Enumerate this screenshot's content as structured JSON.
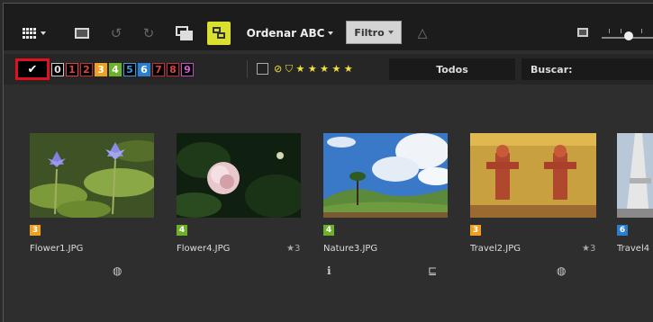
{
  "toolbar": {
    "sort_label": "Ordenar ABC",
    "filter_label": "Filtro",
    "accent_color": "#d9e030"
  },
  "filterbar": {
    "check_glyph": "✔",
    "labels": [
      {
        "text": "0",
        "bg": "#000000",
        "fg": "#e0e0e0",
        "border": "#c8c8c8"
      },
      {
        "text": "1",
        "bg": "#000000",
        "fg": "#e04040",
        "border": "#e04040"
      },
      {
        "text": "2",
        "bg": "#000000",
        "fg": "#e04040",
        "border": "#c03030"
      },
      {
        "text": "3",
        "bg": "#f0a020",
        "fg": "#ffffff",
        "border": "#f0a020"
      },
      {
        "text": "4",
        "bg": "#6fb02a",
        "fg": "#ffffff",
        "border": "#6fb02a"
      },
      {
        "text": "5",
        "bg": "#000000",
        "fg": "#3a9ae0",
        "border": "#3a9ae0"
      },
      {
        "text": "6",
        "bg": "#2a80d0",
        "fg": "#ffffff",
        "border": "#2a80d0"
      },
      {
        "text": "7",
        "bg": "#000000",
        "fg": "#e04040",
        "border": "#c03030"
      },
      {
        "text": "8",
        "bg": "#000000",
        "fg": "#e04040",
        "border": "#c03030"
      },
      {
        "text": "9",
        "bg": "#000000",
        "fg": "#d060d0",
        "border": "#c050c0"
      }
    ],
    "stars_text": "⊘ ⛉ ★ ★ ★ ★ ★",
    "todos_label": "Todos",
    "search_label": "Buscar:"
  },
  "items": [
    {
      "name": "Flower1.JPG",
      "label": "3",
      "label_color": "#f0a020",
      "rating": "",
      "icons": [
        "globe-icon"
      ],
      "icon_glyphs": [
        "◍"
      ]
    },
    {
      "name": "Flower4.JPG",
      "label": "4",
      "label_color": "#6fb02a",
      "rating": "★3",
      "icons": [],
      "icon_glyphs": []
    },
    {
      "name": "Nature3.JPG",
      "label": "4",
      "label_color": "#6fb02a",
      "rating": "",
      "icons": [
        "info-icon",
        "hierarchy-icon"
      ],
      "icon_glyphs": [
        "ℹ",
        "⊑"
      ]
    },
    {
      "name": "Travel2.JPG",
      "label": "3",
      "label_color": "#f0a020",
      "rating": "★3",
      "icons": [
        "globe-icon"
      ],
      "icon_glyphs": [
        "◍"
      ]
    },
    {
      "name": "Travel4",
      "label": "6",
      "label_color": "#2a80d0",
      "rating": "",
      "icons": [],
      "icon_glyphs": []
    }
  ]
}
